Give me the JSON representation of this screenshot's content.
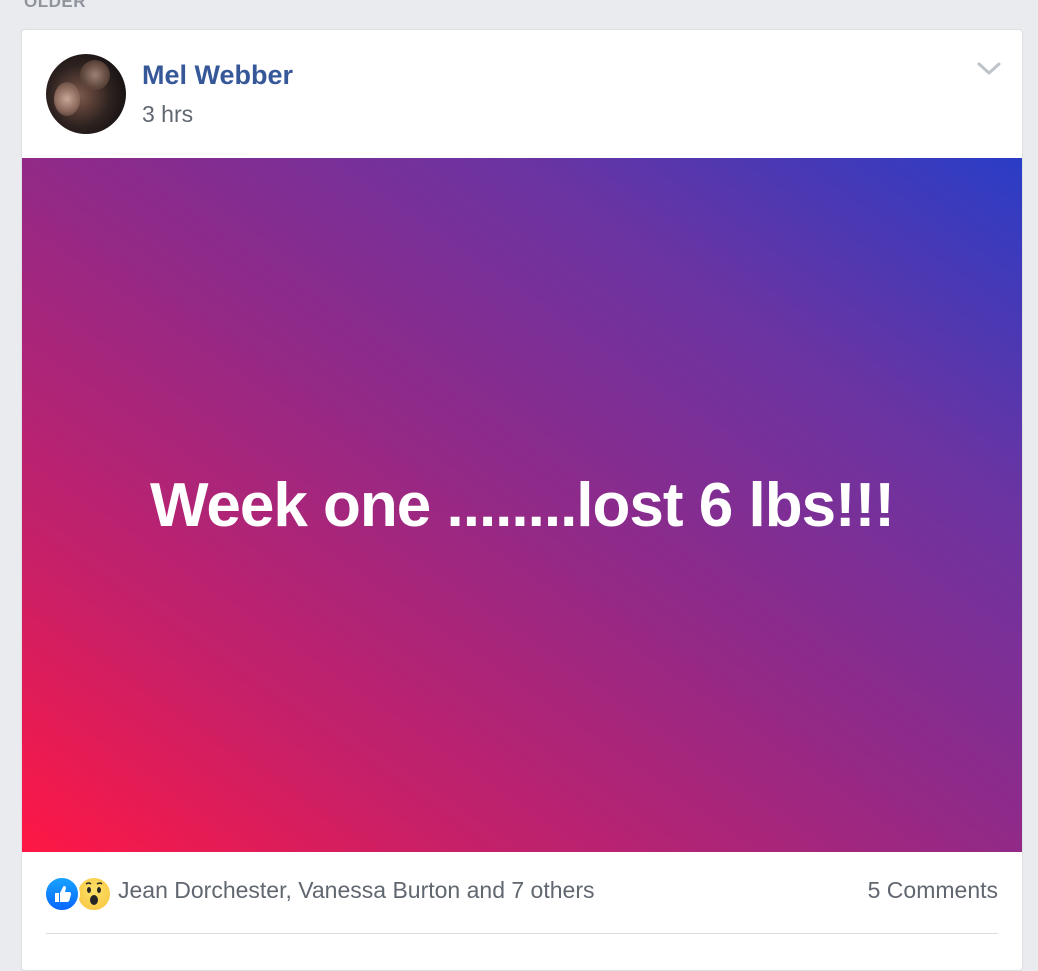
{
  "section": {
    "label": "OLDER"
  },
  "post": {
    "author": "Mel Webber",
    "time": "3 hrs",
    "text": "Week one ........lost 6 lbs!!!",
    "background_gradient": [
      "#ff1744",
      "#c72068",
      "#8e2a8a",
      "#6a34a2",
      "#2a3dc6"
    ],
    "reactions": {
      "icons": [
        "like-icon",
        "wow-icon"
      ],
      "names": "Jean Dorchester, Vanessa Burton and 7 others"
    },
    "comments": "5 Comments"
  },
  "colors": {
    "author": "#365899",
    "meta": "#616770",
    "page_bg": "#e9ebee"
  }
}
